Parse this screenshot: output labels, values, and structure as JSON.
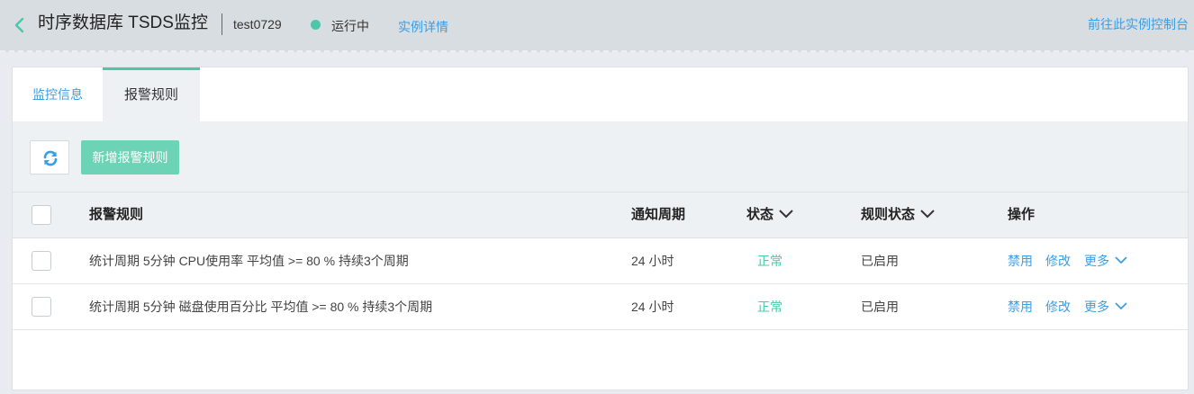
{
  "header": {
    "title": "时序数据库 TSDS监控",
    "instance_name": "test0729",
    "status_text": "运行中",
    "status_color": "#4cc7a8",
    "detail_link": "实例详情",
    "console_link": "前往此实例控制台"
  },
  "tabs": [
    {
      "label": "监控信息",
      "active": false
    },
    {
      "label": "报警规则",
      "active": true
    }
  ],
  "toolbar": {
    "refresh_icon": "refresh-icon",
    "add_label": "新增报警规则"
  },
  "table": {
    "columns": {
      "rule": "报警规则",
      "period": "通知周期",
      "state": "状态",
      "rule_state": "规则状态",
      "ops": "操作"
    },
    "rows": [
      {
        "rule": "统计周期 5分钟 CPU使用率 平均值 >= 80 % 持续3个周期",
        "period": "24 小时",
        "state": "正常",
        "rule_state": "已启用",
        "op_disable": "禁用",
        "op_edit": "修改",
        "op_more": "更多"
      },
      {
        "rule": "统计周期 5分钟 磁盘使用百分比 平均值 >= 80 % 持续3个周期",
        "period": "24 小时",
        "state": "正常",
        "rule_state": "已启用",
        "op_disable": "禁用",
        "op_edit": "修改",
        "op_more": "更多"
      }
    ]
  },
  "colors": {
    "accent_blue": "#3a9ee4",
    "accent_green": "#4cc7a8",
    "button_green": "#6dd3b6"
  }
}
